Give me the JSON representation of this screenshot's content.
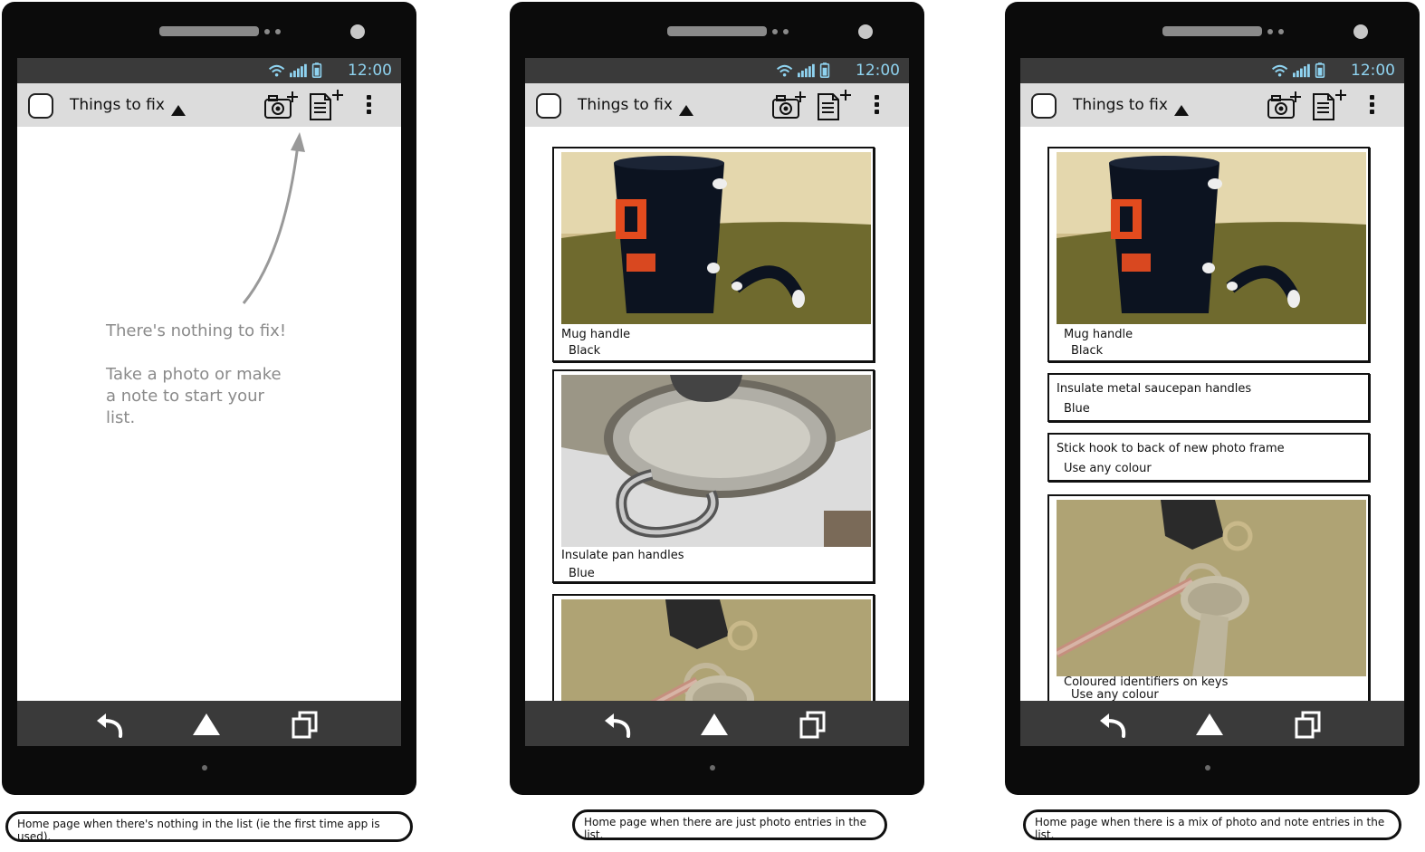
{
  "status_bar": {
    "time": "12:00"
  },
  "action_bar": {
    "title": "Things to fix",
    "icons": [
      "app-icon",
      "caret-up-icon",
      "add-photo-icon",
      "add-note-icon",
      "overflow-menu-icon"
    ]
  },
  "nav_bar": {
    "icons": [
      "back-icon",
      "home-icon",
      "recent-apps-icon"
    ]
  },
  "phones": [
    {
      "empty_state": {
        "line1": "There's nothing to fix!",
        "line2": "Take a photo or make a note to start your list."
      },
      "caption": "Home page when there's nothing in the list (ie the first time app is used)."
    },
    {
      "entries": [
        {
          "type": "photo",
          "image": "mug-photo",
          "title": "Mug handle",
          "detail": "Black"
        },
        {
          "type": "photo",
          "image": "saucepan-photo",
          "title": "Insulate pan handles",
          "detail": "Blue"
        },
        {
          "type": "photo",
          "image": "keys-photo",
          "title": "",
          "detail": ""
        }
      ],
      "caption": "Home page when there are just photo entries in the list."
    },
    {
      "entries": [
        {
          "type": "photo",
          "image": "mug-photo",
          "title": "Mug handle",
          "detail": "Black"
        },
        {
          "type": "note",
          "title": "Insulate metal saucepan handles",
          "detail": "Blue"
        },
        {
          "type": "note",
          "title": "Stick hook to back of new photo frame",
          "detail": "Use any colour"
        },
        {
          "type": "photo",
          "image": "keys-photo",
          "title": "Coloured identifiers on keys",
          "detail": "Use any colour"
        }
      ],
      "caption": "Home page when there is a mix of photo and note entries in the list."
    }
  ],
  "colors": {
    "phone_body": "#0b0b0b",
    "status_bar_bg": "#3a3a3a",
    "status_text": "#8fd3f0",
    "action_bar_bg": "#dcdcdc",
    "hint_text": "#8a8a8a"
  }
}
